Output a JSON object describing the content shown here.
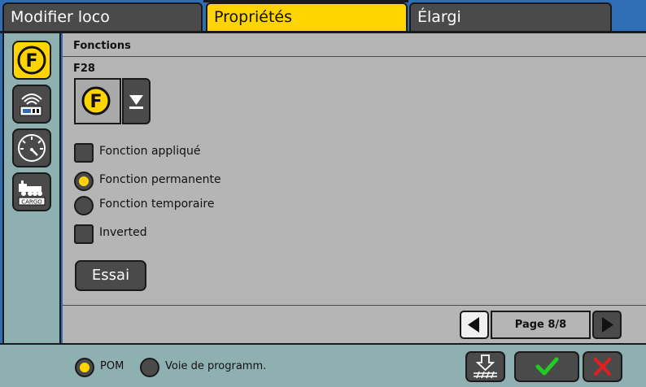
{
  "tabs": [
    {
      "label": "Modifier loco",
      "active": false
    },
    {
      "label": "Propriétés",
      "active": true
    },
    {
      "label": "Élargi",
      "active": false
    }
  ],
  "sidebar": {
    "items": [
      {
        "icon": "function-f-icon",
        "active": true
      },
      {
        "icon": "decoder-wireless-icon",
        "active": false
      },
      {
        "icon": "speedometer-icon",
        "active": false
      },
      {
        "icon": "cargo-train-icon",
        "active": false,
        "caption": "CARGO"
      }
    ]
  },
  "main": {
    "section_title": "Fonctions",
    "function_key": "F28",
    "function_icon": "function-f-icon",
    "options": {
      "applied": {
        "label": "Fonction appliqué",
        "checked": false
      },
      "permanent": {
        "label": "Fonction permanente",
        "selected": true
      },
      "temporary": {
        "label": "Fonction temporaire",
        "selected": false
      },
      "inverted": {
        "label": "Inverted",
        "checked": false
      }
    },
    "test_button": "Essai",
    "pager": {
      "label": "Page 8/8",
      "current": 8,
      "total": 8
    }
  },
  "footer": {
    "pom": {
      "label": "POM",
      "selected": true
    },
    "prog": {
      "label": "Voie de programm.",
      "selected": false
    }
  },
  "colors": {
    "accent": "#ffd400",
    "panel": "#b5b5b5",
    "sidebar": "#8fb0b0",
    "button": "#4a4a4a",
    "topbar": "#2f6db5",
    "confirm": "#22cc22",
    "cancel": "#e02020"
  }
}
